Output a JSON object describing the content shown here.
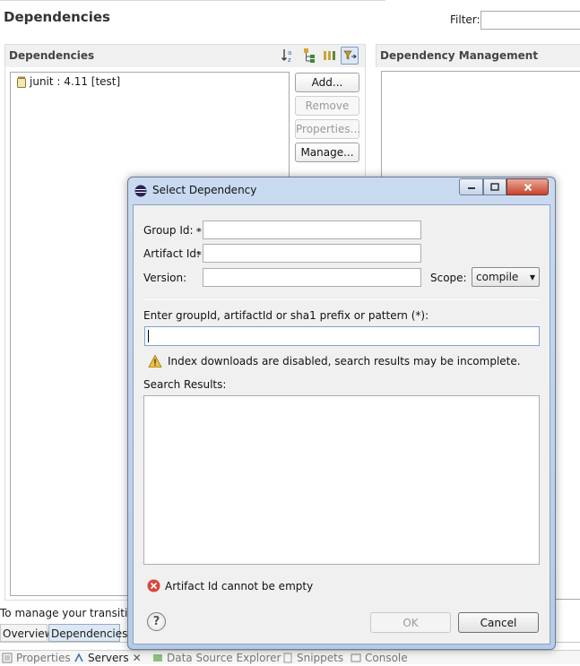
{
  "editor": {
    "title": "Dependencies",
    "filter_label": "Filter:",
    "dependencies_section": {
      "title": "Dependencies",
      "toolbar_icons": [
        "sort-alpha-icon",
        "hierarchy-icon",
        "columns-icon",
        "filter-toggle-icon"
      ],
      "items": [
        {
          "label": "junit : 4.11 [test]",
          "icon": "jar-icon"
        }
      ],
      "buttons": {
        "add": "Add...",
        "remove": "Remove",
        "properties": "Properties...",
        "manage": "Manage..."
      }
    },
    "management_section": {
      "title": "Dependency Management"
    },
    "transitive_text": "To manage your transitive",
    "tabs": [
      "Overview",
      "Dependencies"
    ],
    "views": [
      "Properties",
      "Servers",
      "Data Source Explorer",
      "Snippets",
      "Console"
    ]
  },
  "dialog": {
    "title": "Select Dependency",
    "group_label": "Group Id:",
    "artifact_label": "Artifact Id:",
    "required_marker": "*",
    "version_label": "Version:",
    "scope_label": "Scope:",
    "scope_value": "compile",
    "group_value": "",
    "artifact_value": "",
    "version_value": "",
    "pattern_label": "Enter groupId, artifactId or sha1 prefix or pattern (*):",
    "pattern_value": "",
    "warning": "Index downloads are disabled, search results may be incomplete.",
    "results_label": "Search Results:",
    "error": "Artifact Id cannot be empty",
    "help_symbol": "?",
    "ok_label": "OK",
    "cancel_label": "Cancel"
  },
  "colors": {
    "accent": "#7da2ce",
    "error": "#d9463a",
    "warning": "#f0c23a",
    "titlebar": "#b5cbe7"
  }
}
